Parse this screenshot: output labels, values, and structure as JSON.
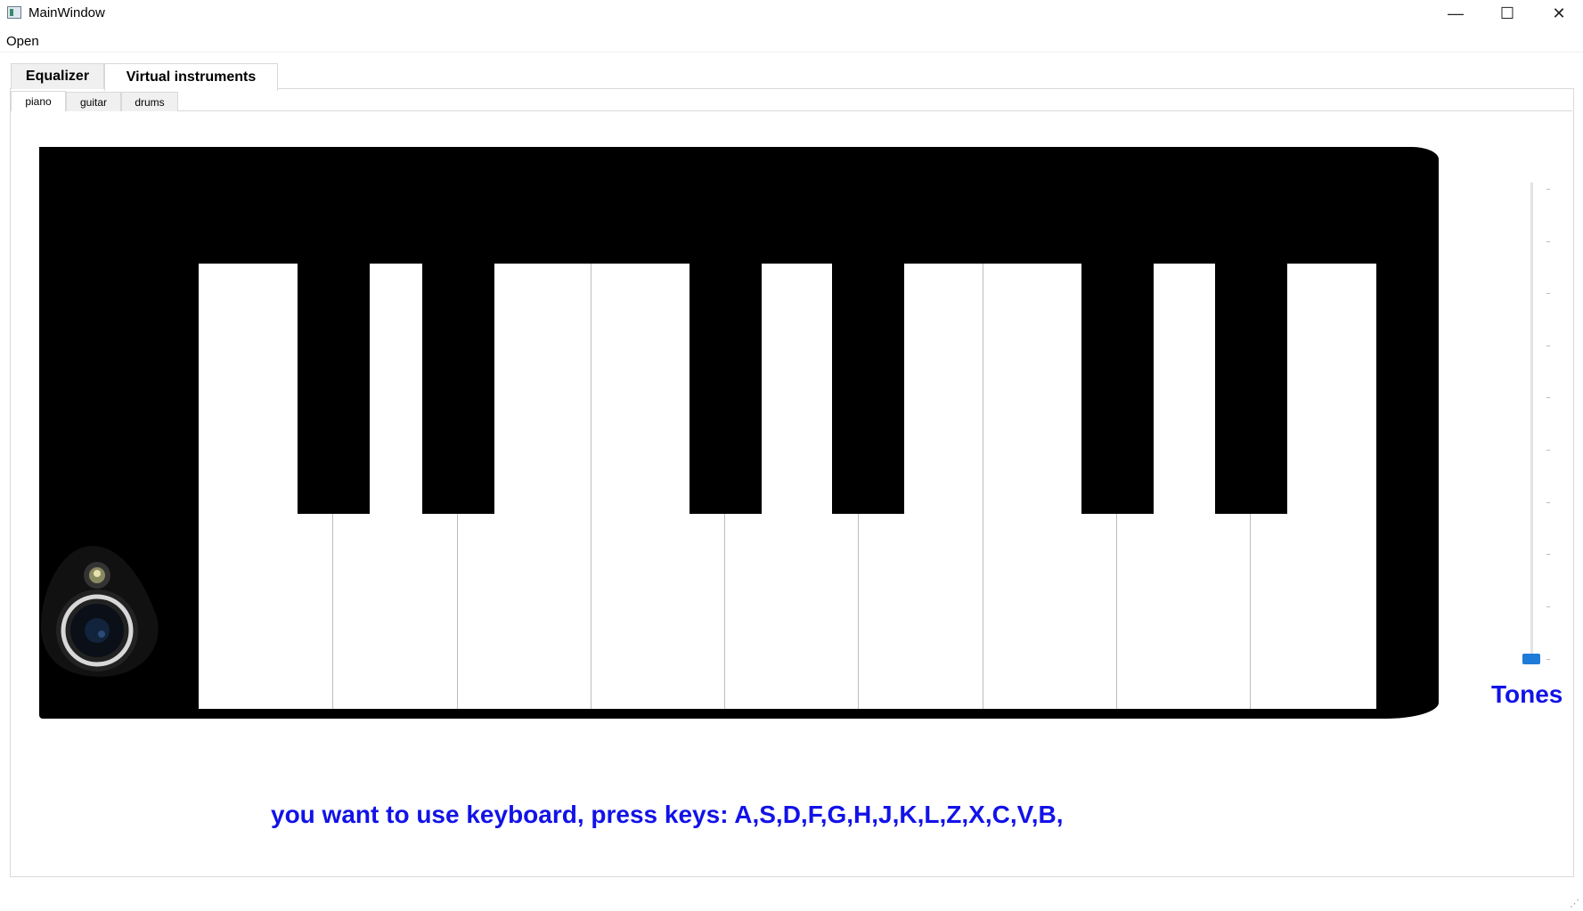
{
  "window": {
    "title": "MainWindow",
    "controls": {
      "minimize": "—",
      "maximize": "☐",
      "close": "✕"
    }
  },
  "menu": {
    "items": [
      "Open"
    ]
  },
  "tabs": {
    "outer": [
      {
        "label": "Equalizer",
        "selected": false
      },
      {
        "label": "Virtual instruments",
        "selected": true
      }
    ],
    "inner": [
      {
        "label": "piano",
        "selected": true
      },
      {
        "label": "guitar",
        "selected": false
      },
      {
        "label": "drums",
        "selected": false
      }
    ]
  },
  "piano": {
    "white_key_count": 9,
    "black_key_count": 6
  },
  "tones": {
    "label": "Tones",
    "slider_value_fraction": 0.0
  },
  "instruction": "you want to use keyboard, press keys: A,S,D,F,G,H,J,K,L,Z,X,C,V,B,",
  "colors": {
    "accent_text": "#1212e8",
    "slider_handle": "#1e7bd7",
    "piano_body": "#000000",
    "white_key": "#ffffff"
  },
  "icons": {
    "app": "app-icon",
    "camera": "camera-icon"
  }
}
